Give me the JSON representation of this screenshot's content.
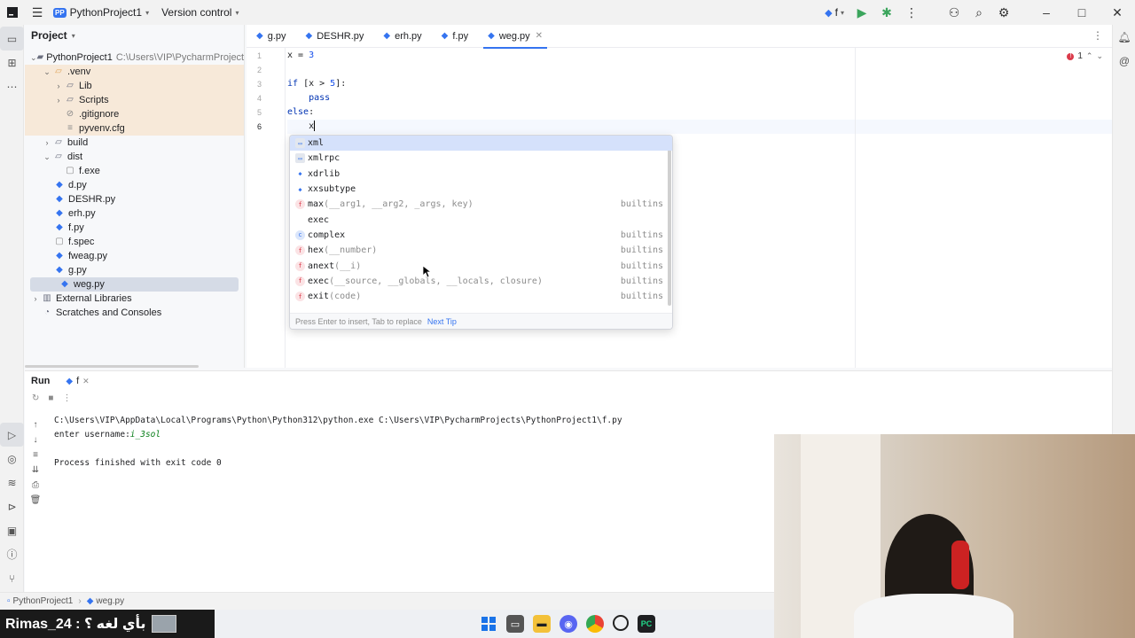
{
  "title_bar": {
    "project_badge": "PP",
    "project_name": "PythonProject1",
    "vcs_menu": "Version control",
    "run_config": "f"
  },
  "project_panel": {
    "title": "Project",
    "root": {
      "name": "PythonProject1",
      "path": "C:\\Users\\VIP\\PycharmProjects\\Py"
    },
    "items": [
      {
        "label": ".venv"
      },
      {
        "label": "Lib"
      },
      {
        "label": "Scripts"
      },
      {
        "label": ".gitignore"
      },
      {
        "label": "pyvenv.cfg"
      },
      {
        "label": "build"
      },
      {
        "label": "dist"
      },
      {
        "label": "f.exe"
      },
      {
        "label": "d.py"
      },
      {
        "label": "DESHR.py"
      },
      {
        "label": "erh.py"
      },
      {
        "label": "f.py"
      },
      {
        "label": "f.spec"
      },
      {
        "label": "fweag.py"
      },
      {
        "label": "g.py"
      },
      {
        "label": "weg.py"
      },
      {
        "label": "External Libraries"
      },
      {
        "label": "Scratches and Consoles"
      }
    ]
  },
  "editor": {
    "tabs": [
      {
        "label": "g.py"
      },
      {
        "label": "DESHR.py"
      },
      {
        "label": "erh.py"
      },
      {
        "label": "f.py"
      },
      {
        "label": "weg.py"
      }
    ],
    "error_count": "1",
    "line_numbers": [
      "1",
      "2",
      "3",
      "4",
      "5",
      "6"
    ],
    "code": {
      "l1_a": "x = ",
      "l1_num": "3",
      "l3_kw": "if",
      "l3_a": " [x > ",
      "l3_num": "5",
      "l3_b": "]:",
      "l4_kw": "    pass",
      "l5_kw": "else",
      "l5_b": ":",
      "l6_a": "    x"
    }
  },
  "completion": {
    "items": [
      {
        "name": "xml",
        "sig": "",
        "source": ""
      },
      {
        "name": "xmlrpc",
        "sig": "",
        "source": ""
      },
      {
        "name": "xdrlib",
        "sig": "",
        "source": ""
      },
      {
        "name": "xxsubtype",
        "sig": "",
        "source": ""
      },
      {
        "name": "max",
        "sig": "(__arg1, __arg2, _args, key)",
        "source": "builtins"
      },
      {
        "name": "exec",
        "sig": "",
        "source": ""
      },
      {
        "name": "complex",
        "sig": "",
        "source": "builtins"
      },
      {
        "name": "hex",
        "sig": "(__number)",
        "source": "builtins"
      },
      {
        "name": "anext",
        "sig": "(__i)",
        "source": "builtins"
      },
      {
        "name": "exec",
        "sig": "(__source, __globals, __locals, closure)",
        "source": "builtins"
      },
      {
        "name": "exit",
        "sig": "(code)",
        "source": "builtins"
      }
    ],
    "footer_hint": "Press Enter to insert, Tab to replace",
    "footer_link": "Next Tip"
  },
  "run_panel": {
    "title": "Run",
    "tab": "f",
    "console": {
      "line1": "C:\\Users\\VIP\\AppData\\Local\\Programs\\Python\\Python312\\python.exe C:\\Users\\VIP\\PycharmProjects\\PythonProject1\\f.py",
      "prompt": "enter username:",
      "user_input": "i_3sol",
      "line3": "Process finished with exit code 0"
    }
  },
  "status_bar": {
    "project": "PythonProject1",
    "file": "weg.py"
  },
  "taskbar": {
    "overlay_text": "Rimas_24 : بأي لغه ؟"
  },
  "colors": {
    "accent": "#3574f0",
    "error": "#db3b4b",
    "excluded_bg": "#f7e9d9",
    "selected_bg": "#d5dbe6"
  }
}
